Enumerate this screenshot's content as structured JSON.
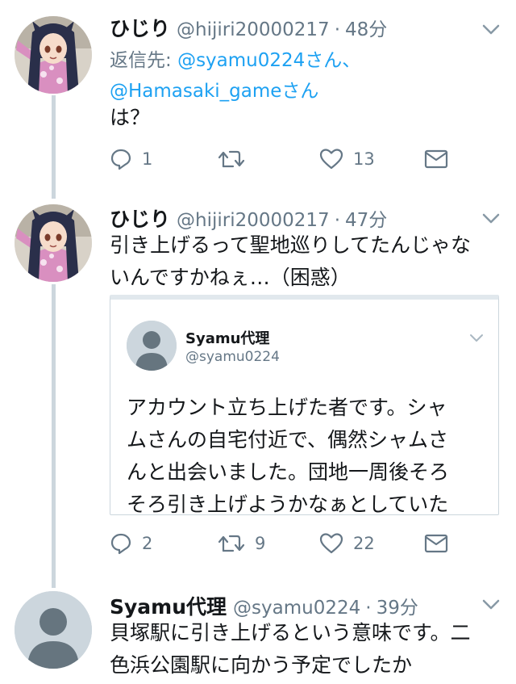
{
  "tweets": [
    {
      "name": "ひじり",
      "handle": "@hijiri20000217",
      "separator": "·",
      "time": "48分",
      "reply_prefix": "返信先: ",
      "reply_users": [
        "@syamu0224さん、",
        "@Hamasaki_gameさん"
      ],
      "text": "は？",
      "actions": {
        "replies": "1",
        "retweets": "",
        "likes": "13"
      }
    },
    {
      "name": "ひじり",
      "handle": "@hijiri20000217",
      "separator": "·",
      "time": "47分",
      "text_lines": [
        "引き上げるって聖地巡りしてたんじゃな",
        "いんですかねぇ…（困惑）"
      ],
      "quote": {
        "name": "Syamu代理",
        "handle": "@syamu0224",
        "text_lines": [
          "アカウント立ち上げた者です。シャ",
          "ムさんの自宅付近で、偶然シャムさ",
          "んと出会いました。団地一周後そろ",
          "そろ引き上げようかなぁとしていた"
        ]
      },
      "actions": {
        "replies": "2",
        "retweets": "9",
        "likes": "22"
      }
    },
    {
      "name": "Syamu代理",
      "handle": "@syamu0224",
      "separator": "·",
      "time": "39分",
      "text_lines": [
        "貝塚駅に引き上げるという意味です。二",
        "色浜公園駅に向かう予定でしたか"
      ]
    }
  ],
  "colors": {
    "link": "#1da1f2",
    "secondary": "#657786",
    "thread_line": "#ccd6dd"
  },
  "icons": [
    "reply-icon",
    "retweet-icon",
    "like-icon",
    "dm-icon",
    "chevron-down-icon"
  ]
}
